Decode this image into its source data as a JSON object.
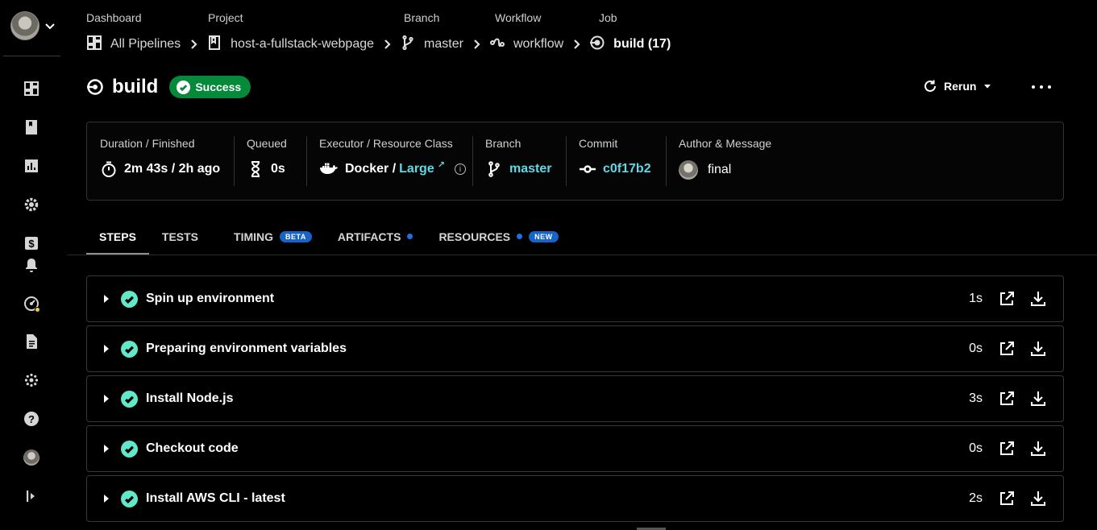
{
  "sidebar": {
    "items": [
      {
        "name": "dashboard-icon"
      },
      {
        "name": "projects-icon"
      },
      {
        "name": "insights-icon"
      },
      {
        "name": "settings-icon"
      },
      {
        "name": "plan-icon"
      },
      {
        "name": "notifications-icon"
      },
      {
        "name": "status-icon"
      },
      {
        "name": "docs-icon"
      },
      {
        "name": "integrations-icon"
      },
      {
        "name": "help-icon"
      },
      {
        "name": "profile-avatar"
      },
      {
        "name": "expand-sidebar-icon"
      }
    ]
  },
  "breadcrumb": {
    "labels": [
      "Dashboard",
      "Project",
      "Branch",
      "Workflow",
      "Job"
    ],
    "items": [
      "All Pipelines",
      "host-a-fullstack-webpage",
      "master",
      "workflow",
      "build (17)"
    ]
  },
  "header": {
    "title": "build",
    "status": "Success",
    "rerun_label": "Rerun"
  },
  "info": {
    "duration_label": "Duration / Finished",
    "duration_value": "2m 43s / 2h ago",
    "queued_label": "Queued",
    "queued_value": "0s",
    "executor_label": "Executor / Resource Class",
    "executor_value": "Docker / ",
    "resource_class": "Large",
    "branch_label": "Branch",
    "branch_value": "master",
    "commit_label": "Commit",
    "commit_value": "c0f17b2",
    "author_label": "Author & Message",
    "message": "final"
  },
  "tabs": {
    "steps": "STEPS",
    "tests": "TESTS",
    "timing": "TIMING",
    "timing_badge": "BETA",
    "artifacts": "ARTIFACTS",
    "resources": "RESOURCES",
    "resources_badge": "NEW"
  },
  "steps": [
    {
      "name": "Spin up environment",
      "duration": "1s"
    },
    {
      "name": "Preparing environment variables",
      "duration": "0s"
    },
    {
      "name": "Install Node.js",
      "duration": "3s"
    },
    {
      "name": "Checkout code",
      "duration": "0s"
    },
    {
      "name": "Install AWS CLI - latest",
      "duration": "2s"
    }
  ],
  "colors": {
    "success_badge": "#05893a",
    "step_check": "#61e8c9",
    "link_teal": "#5fd9e6",
    "pill_blue": "#1764c9"
  }
}
